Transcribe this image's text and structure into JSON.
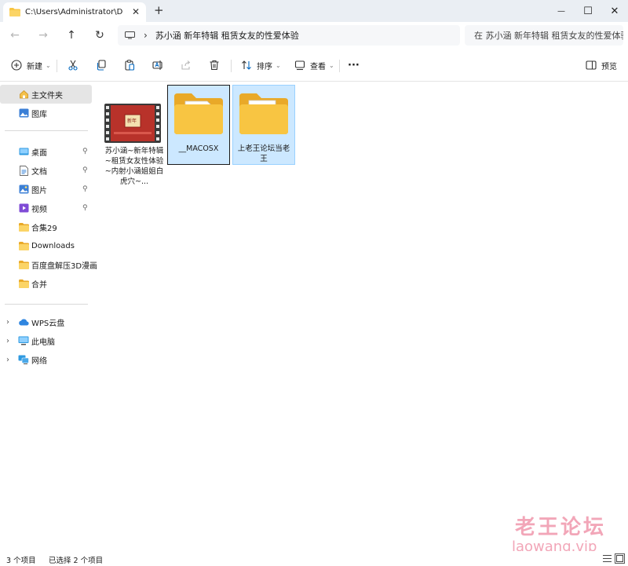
{
  "window": {
    "tab_title": "C:\\Users\\Administrator\\Desktop",
    "tab_close": "✕",
    "new_tab": "+",
    "minimize": "—",
    "maximize": "☐",
    "close": "✕"
  },
  "navigation": {
    "back": "←",
    "forward": "→",
    "up": "↑",
    "refresh": "↻",
    "breadcrumb_separator": "›",
    "path": "苏小涵 新年特辑 租赁女友的性爱体验",
    "search_placeholder": "在 苏小涵 新年特辑 租赁女友的性爱体验 中搜索"
  },
  "toolbar": {
    "new_label": "新建",
    "sort_label": "排序",
    "view_label": "查看",
    "more": "···",
    "preview_label": "预览"
  },
  "sidebar": {
    "top": [
      {
        "label": "主文件夹",
        "icon": "home-icon",
        "selected": true
      },
      {
        "label": "图库",
        "icon": "gallery-icon"
      }
    ],
    "quick_access": [
      {
        "label": "桌面",
        "icon": "desktop-icon",
        "pinned": true
      },
      {
        "label": "文档",
        "icon": "documents-icon",
        "pinned": true
      },
      {
        "label": "图片",
        "icon": "pictures-icon",
        "pinned": true
      },
      {
        "label": "视频",
        "icon": "videos-icon",
        "pinned": true
      },
      {
        "label": "合集29",
        "icon": "folder-icon"
      },
      {
        "label": "Downloads",
        "icon": "folder-icon"
      },
      {
        "label": "百度盘解压3D漫画",
        "icon": "folder-icon"
      },
      {
        "label": "合并",
        "icon": "folder-icon"
      }
    ],
    "pin_glyph": "📌",
    "expander": "›",
    "roots": [
      {
        "label": "WPS云盘",
        "icon": "cloud-icon"
      },
      {
        "label": "此电脑",
        "icon": "computer-icon"
      },
      {
        "label": "网络",
        "icon": "network-icon"
      }
    ]
  },
  "files": [
    {
      "name": "苏小涵~新年特辑~租赁女友性体验~内射小涵姐姐白虎穴~...",
      "type": "video",
      "thumb_text": "新年"
    },
    {
      "name": "__MACOSX",
      "type": "folder"
    },
    {
      "name": "上老王论坛当老王",
      "type": "folder"
    }
  ],
  "status": {
    "item_count": "3 个项目",
    "selected_count": "已选择 2 个项目"
  },
  "watermark": {
    "line1": "老王论坛",
    "line2": "laowang.vip"
  },
  "colors": {
    "folder": "#f8c542",
    "selection": "#cce8ff",
    "accent": "#0067c0"
  }
}
